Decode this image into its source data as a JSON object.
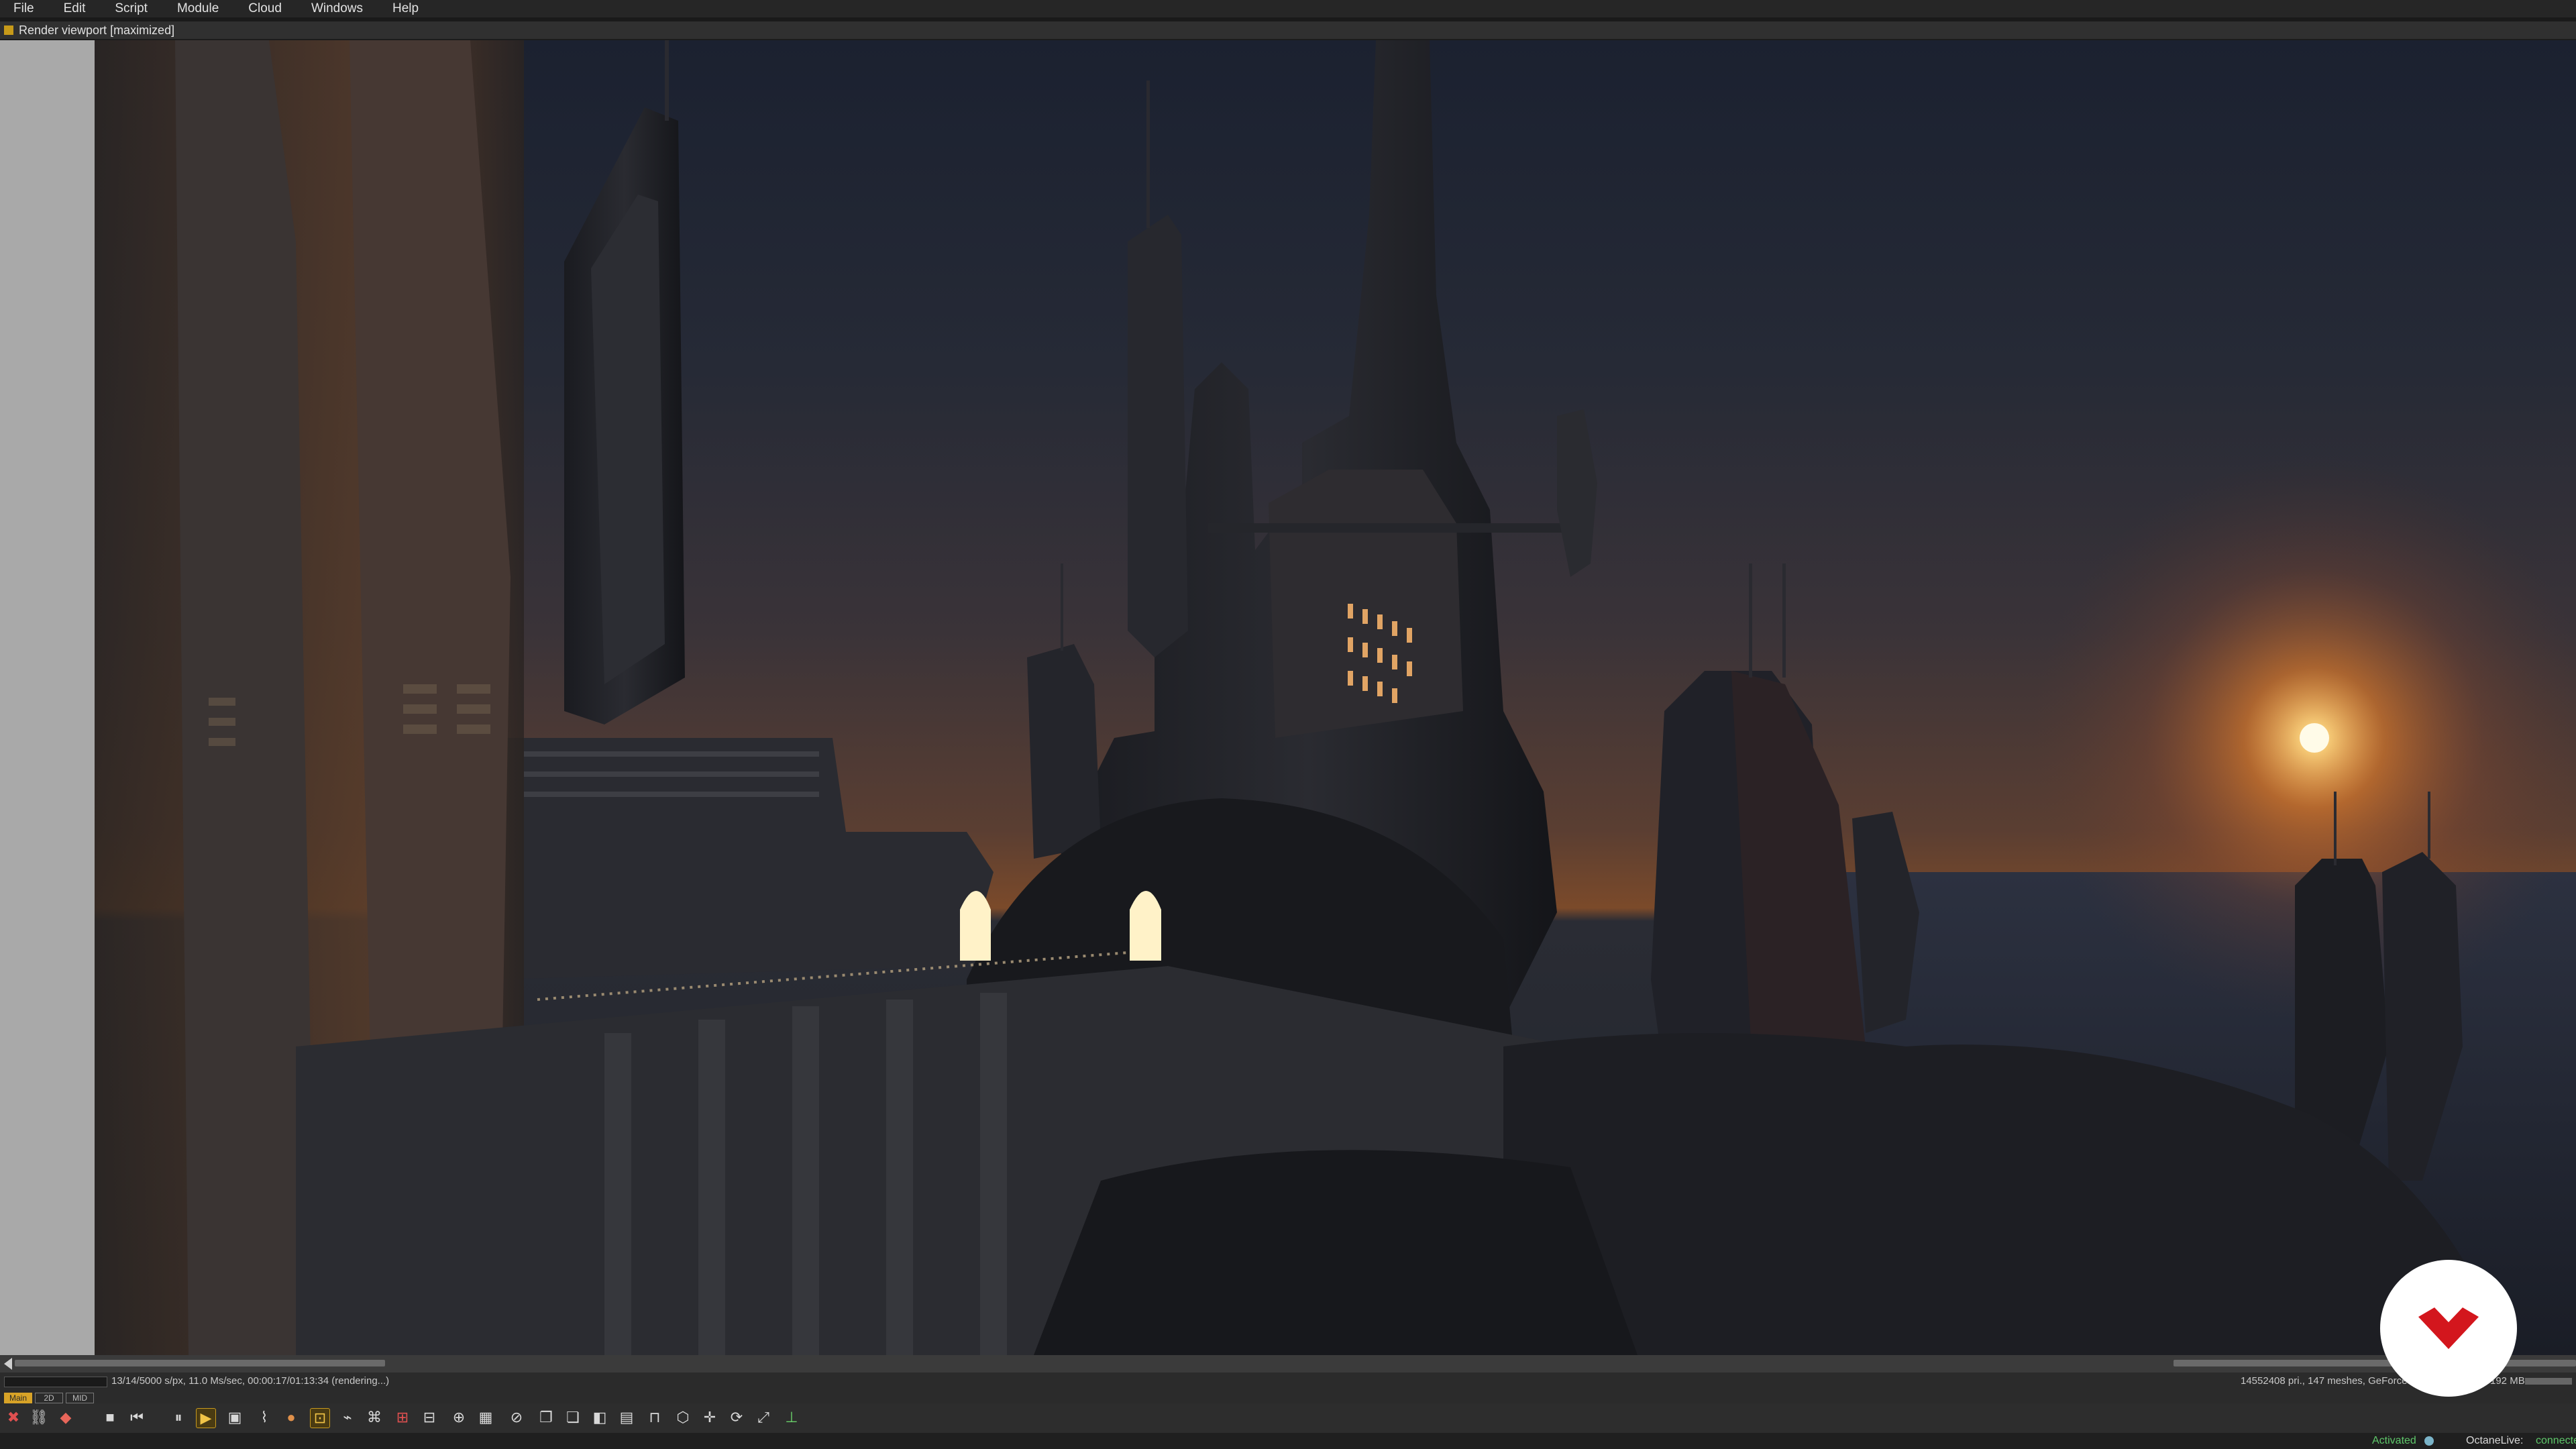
{
  "menu": [
    "File",
    "Edit",
    "Script",
    "Module",
    "Cloud",
    "Windows",
    "Help"
  ],
  "viewport": {
    "title": "Render viewport [maximized]"
  },
  "status": {
    "left": "13/14/5000 s/px, 11.0 Ms/sec, 00:00:17/01:13:34 (rendering...)",
    "right": "14552408 pri., 147 meshes, GeForce GT",
    "memory": "192 MB"
  },
  "mode_tabs": [
    "Main",
    "2D",
    "MID"
  ],
  "toolbar_icons": [
    "clear-icon",
    "link-icon",
    "color-icon",
    "stop-icon",
    "restart-icon",
    "pause-icon",
    "play-icon",
    "region-icon",
    "graph-icon",
    "sphere-icon",
    "lock-icon",
    "film-icon",
    "focus-icon",
    "pick-icon",
    "crop-icon",
    "zoom-icon",
    "frame-icon",
    "picker-icon",
    "copy-icon",
    "paste-icon",
    "layers-icon",
    "save-icon",
    "lock2-icon",
    "cube-icon",
    "move-icon",
    "rotate-icon",
    "fit-icon",
    "axis-icon"
  ],
  "bottom": {
    "activated": "Activated",
    "octane_label": "OctaneLive:",
    "octane_status": "connected"
  },
  "colors": {
    "accent": "#d8a327",
    "logo": "#d3161d"
  }
}
